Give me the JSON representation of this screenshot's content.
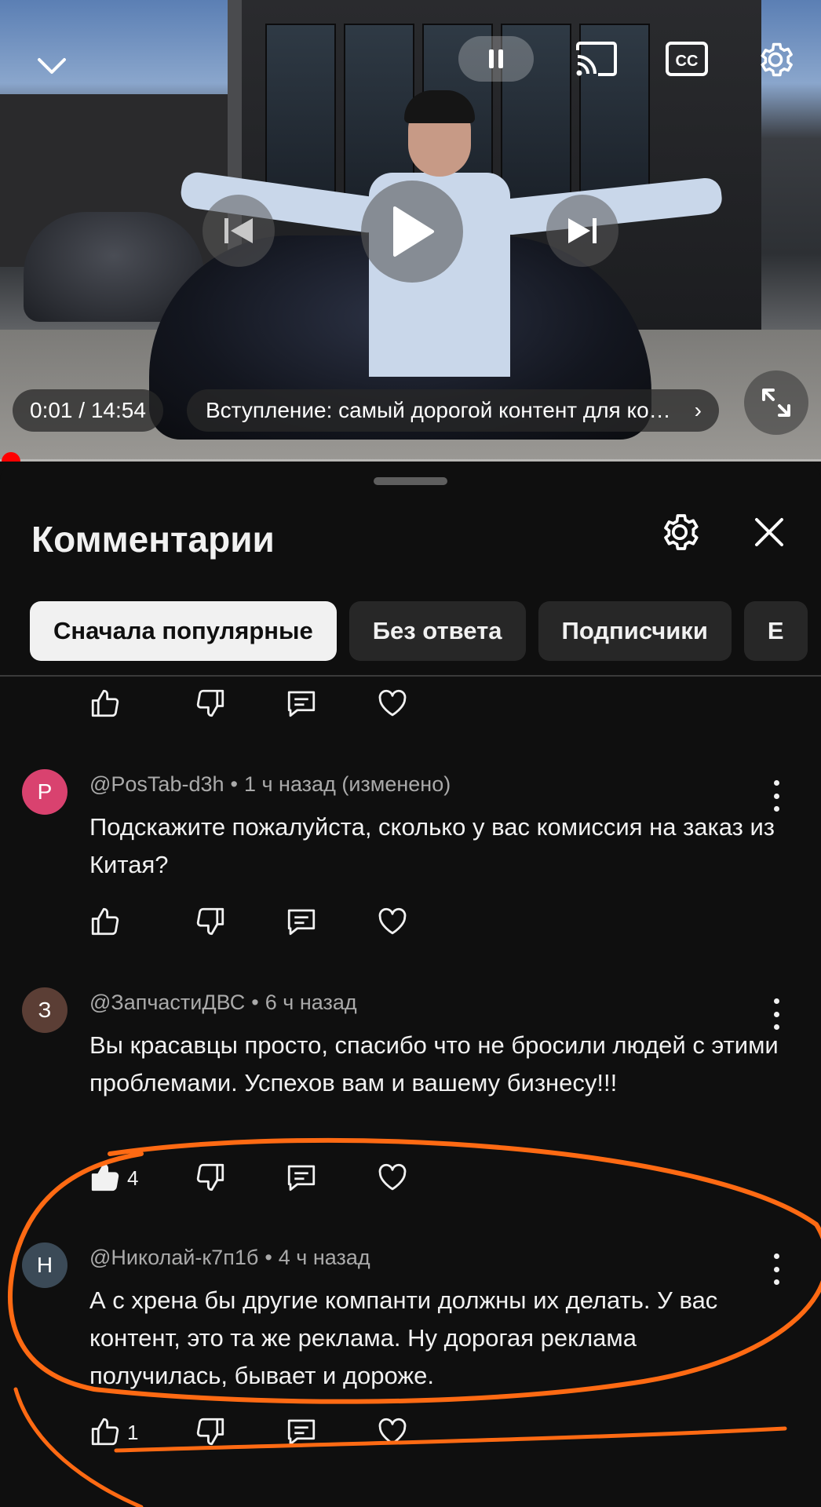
{
  "player": {
    "time": "0:01 / 14:54",
    "chapter": "Вступление: самый дорогой контент для компаний",
    "chapter_chevron": "›",
    "icons": {
      "collapse": "chevron-down-icon",
      "pause": "pause-icon",
      "cast": "cast-icon",
      "captions": "cc-icon",
      "settings": "gear-icon",
      "previous": "skip-previous-icon",
      "play": "play-icon",
      "next": "skip-next-icon",
      "fullscreen": "fullscreen-icon"
    },
    "captions_label": "CC",
    "progress_color": "#ff0000"
  },
  "comments_panel": {
    "title": "Комментарии",
    "chips": [
      {
        "label": "Сначала популярные",
        "active": true
      },
      {
        "label": "Без ответа",
        "active": false
      },
      {
        "label": "Подписчики",
        "active": false
      },
      {
        "label": "Е",
        "active": false
      }
    ]
  },
  "comments": [
    {
      "avatar_letter": "P",
      "avatar_color": "#d9426f",
      "author": "@PosTab-d3h",
      "time": "1 ч назад (изменено)",
      "text": "Подскажите пожалуйста, сколько у вас комиссия на заказ из   Китая?",
      "likes": ""
    },
    {
      "avatar_letter": "З",
      "avatar_color": "#5b3e35",
      "author": "@ЗапчастиДВС",
      "time": "6 ч назад",
      "text": "Вы красавцы просто, спасибо что не бросили людей с этими проблемами. Успехов вам и вашему бизнесу!!!",
      "likes": "4"
    },
    {
      "avatar_letter": "Н",
      "avatar_color": "#3b4a57",
      "author": "@Николай-к7п1б",
      "time": "4 ч назад",
      "text": "А с хрена бы другие компанти должны их делать. У вас контент, это та же реклама. Ну дорогая реклама получилась, бывает и дороже.",
      "likes": "1"
    }
  ],
  "separator": "•",
  "annotation_color": "#ff6a13"
}
